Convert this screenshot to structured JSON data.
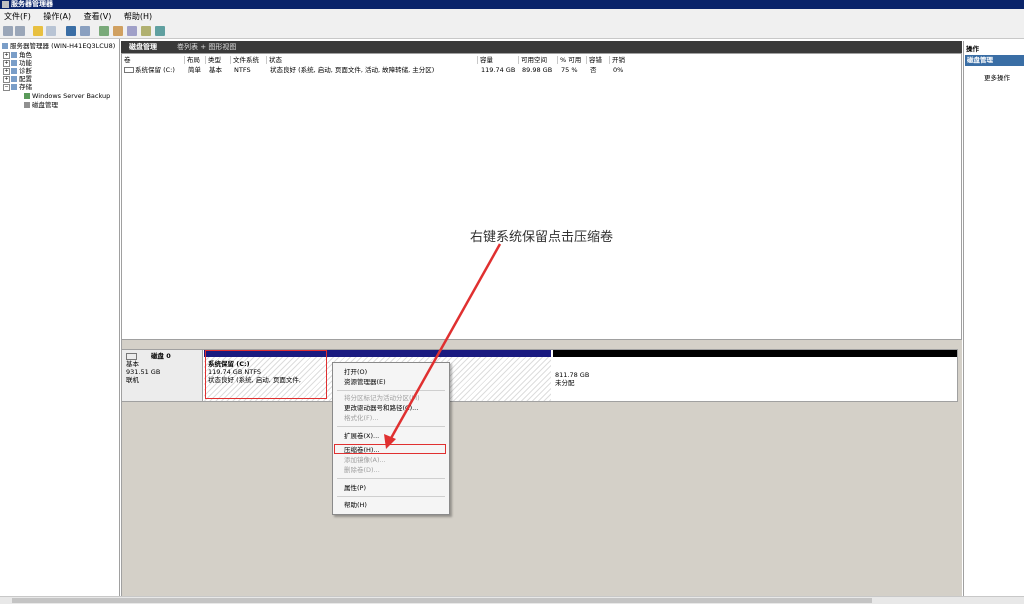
{
  "window": {
    "title": "服务器管理器"
  },
  "menu": [
    "文件(F)",
    "操作(A)",
    "查看(V)",
    "帮助(H)"
  ],
  "tree": {
    "root": "服务器管理器 (WIN-H41EQ3LCU8)",
    "items": [
      "角色",
      "功能",
      "诊断",
      "配置",
      "存储"
    ],
    "storage_children": [
      "Windows Server Backup",
      "磁盘管理"
    ]
  },
  "main_header": {
    "title": "磁盘管理",
    "subtitle": "卷列表 + 图形视图"
  },
  "volume_table": {
    "headers": [
      "卷",
      "布局",
      "类型",
      "文件系统",
      "状态",
      "容量",
      "可用空间",
      "% 可用",
      "容错",
      "开销"
    ],
    "rows": [
      [
        "系统保留 (C:)",
        "简单",
        "基本",
        "NTFS",
        "状态良好 (系统, 启动, 页面文件, 活动, 故障转储, 主分区)",
        "119.74 GB",
        "89.98 GB",
        "75 %",
        "否",
        "0%"
      ]
    ]
  },
  "annotation": "右键系统保留点击压缩卷",
  "disk": {
    "name": "磁盘 0",
    "type": "基本",
    "size": "931.51 GB",
    "status": "联机",
    "partitions": [
      {
        "name": "系统保留  (C:)",
        "detail": "119.74 GB NTFS",
        "status": "状态良好 (系统, 启动, 页面文件,",
        "fill": 0.13
      },
      {
        "name": "",
        "detail": "811.78 GB",
        "status": "未分配",
        "fill": 0.87
      }
    ]
  },
  "context_menu": {
    "items": [
      {
        "label": "打开(O)",
        "enabled": true
      },
      {
        "label": "资源管理器(E)",
        "enabled": true
      },
      {
        "label": "将分区标记为活动分区(M)",
        "enabled": false
      },
      {
        "label": "更改驱动器号和路径(C)...",
        "enabled": true
      },
      {
        "label": "格式化(F)...",
        "enabled": false
      },
      {
        "label": "扩展卷(X)...",
        "enabled": true
      },
      {
        "label": "压缩卷(H)...",
        "enabled": true
      },
      {
        "label": "添加镜像(A)...",
        "enabled": false
      },
      {
        "label": "删除卷(D)...",
        "enabled": false
      },
      {
        "label": "属性(P)",
        "enabled": true
      },
      {
        "label": "帮助(H)",
        "enabled": true
      }
    ]
  },
  "actions": {
    "title": "操作",
    "section": "磁盘管理",
    "more": "更多操作"
  },
  "colors": {
    "accent": "#0a246a",
    "highlight": "#e03030",
    "primary_partition": "#1a1a80"
  }
}
